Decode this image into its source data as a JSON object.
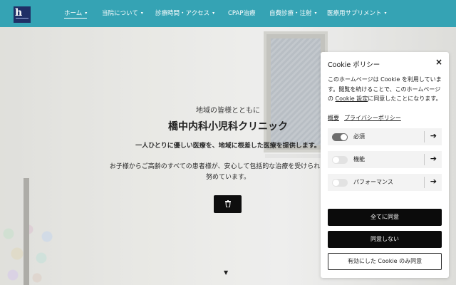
{
  "header": {
    "logo_text": "h",
    "nav": [
      {
        "label": "ホーム",
        "has_dropdown": true,
        "active": true
      },
      {
        "label": "当院について",
        "has_dropdown": true
      },
      {
        "label": "診療時間・アクセス",
        "has_dropdown": true
      },
      {
        "label": "CPAP治療",
        "has_dropdown": false
      },
      {
        "label": "自費診療・注射",
        "has_dropdown": true
      },
      {
        "label": "医療用サプリメント",
        "has_dropdown": true
      }
    ],
    "chevron": "▾"
  },
  "hero": {
    "subtitle": "地域の皆様とともに",
    "title": "橋中内科小児科クリニック",
    "line1": "一人ひとりに優しい医療を、地域に根差した医療を提供します。",
    "line2": "お子様からご高齢のすべての患者様が、安心して包括的な治療を受けられるよう",
    "line3": "努めています。",
    "button_icon": "trash-icon",
    "scroll_icon": "▼"
  },
  "cookie": {
    "title": "Cookie ポリシー",
    "close": "×",
    "desc_part1": "このホームページは Cookie を利用しています。閲覧を続けることで、このホームページの ",
    "desc_link": "Cookie 設定",
    "desc_part2": "に同意したことになります。",
    "link_summary": "概要",
    "link_privacy": "プライバシーポリシー",
    "rows": [
      {
        "label": "必須",
        "enabled": true
      },
      {
        "label": "機能",
        "enabled": false
      },
      {
        "label": "パフォーマンス",
        "enabled": false
      }
    ],
    "arrow": "➔",
    "accept_all": "全てに同意",
    "decline": "同意しない",
    "accept_enabled": "有効にした Cookie のみ同意"
  },
  "colors": {
    "header": "#35a3b4",
    "logo": "#1f2f66",
    "button_dark": "#0b0b0b"
  }
}
